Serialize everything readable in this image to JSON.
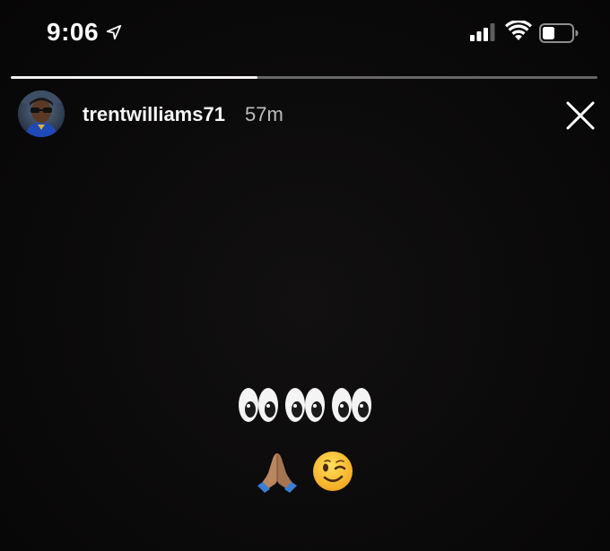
{
  "status_bar": {
    "time": "9:06",
    "icons": [
      "location-arrow-icon",
      "cellular-signal-icon",
      "wifi-icon",
      "battery-icon"
    ]
  },
  "story": {
    "progress": 0.42,
    "username": "trentwilliams71",
    "timestamp": "57m",
    "close_icon": "close-icon",
    "content": {
      "line1": "👀👀👀",
      "line2": "🙏🏽😉"
    }
  },
  "colors": {
    "background": "#0a0909",
    "text": "#ffffff",
    "timestamp": "#bdbdbd",
    "progress_fill": "#f2f2f2"
  }
}
